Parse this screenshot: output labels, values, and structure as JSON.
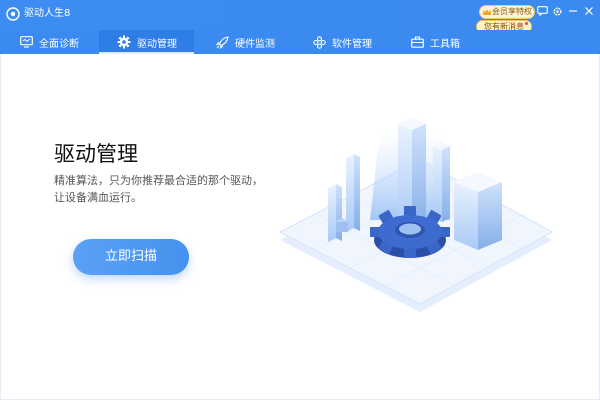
{
  "window": {
    "title": "驱动人生8",
    "vip_badge": "会员享特权",
    "message_badge": "您有新消息",
    "brand_color": "#3b8af0"
  },
  "tabs": [
    {
      "label": "全面诊断",
      "icon": "monitor-icon",
      "active": false
    },
    {
      "label": "驱动管理",
      "icon": "gear-icon",
      "active": true
    },
    {
      "label": "硬件监测",
      "icon": "rocket-icon",
      "active": false
    },
    {
      "label": "软件管理",
      "icon": "apps-icon",
      "active": false
    },
    {
      "label": "工具箱",
      "icon": "toolbox-icon",
      "active": false
    }
  ],
  "main": {
    "heading": "驱动管理",
    "description_line1": "精准算法，只为你推荐最合适的那个驱动，",
    "description_line2": "让设备满血运行。",
    "scan_button": "立即扫描"
  }
}
